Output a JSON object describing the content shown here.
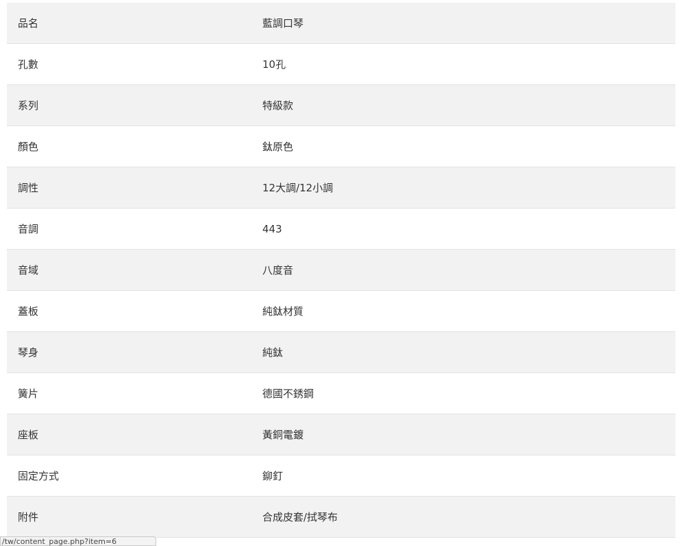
{
  "specs": [
    {
      "label": "品名",
      "value": "藍調口琴"
    },
    {
      "label": "孔數",
      "value": "10孔"
    },
    {
      "label": "系列",
      "value": "特級款"
    },
    {
      "label": "顏色",
      "value": "鈦原色"
    },
    {
      "label": "調性",
      "value": "12大調/12小調"
    },
    {
      "label": "音調",
      "value": "443"
    },
    {
      "label": "音域",
      "value": "八度音"
    },
    {
      "label": "蓋板",
      "value": "純鈦材質"
    },
    {
      "label": "琴身",
      "value": "純鈦"
    },
    {
      "label": "簧片",
      "value": "德國不銹鋼"
    },
    {
      "label": "座板",
      "value": "黃銅電鍍"
    },
    {
      "label": "固定方式",
      "value": "鉚釘"
    },
    {
      "label": "附件",
      "value": "合成皮套/拭琴布"
    }
  ],
  "status_bar": {
    "url": "/tw/content_page.php?item=6"
  }
}
